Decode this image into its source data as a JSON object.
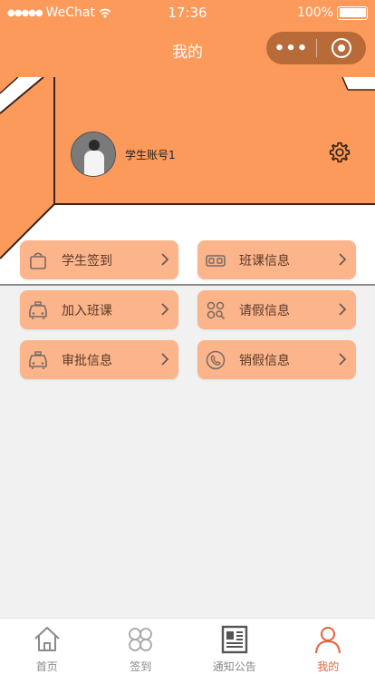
{
  "status_bar": {
    "carrier": "WeChat",
    "time": "17:36",
    "battery": "100%"
  },
  "nav": {
    "title": "我的"
  },
  "profile": {
    "username": "学生账号1"
  },
  "menu": [
    {
      "label": "学生签到",
      "icon": "bag-icon"
    },
    {
      "label": "班课信息",
      "icon": "vr-glasses-icon"
    },
    {
      "label": "加入班课",
      "icon": "taxi-icon"
    },
    {
      "label": "请假信息",
      "icon": "grid-search-icon"
    },
    {
      "label": "审批信息",
      "icon": "taxi-icon"
    },
    {
      "label": "销假信息",
      "icon": "phone-icon"
    }
  ],
  "tabbar": {
    "items": [
      {
        "label": "首页",
        "icon": "home-icon"
      },
      {
        "label": "签到",
        "icon": "clover-icon"
      },
      {
        "label": "通知公告",
        "icon": "newspaper-icon"
      },
      {
        "label": "我的",
        "icon": "user-icon"
      }
    ],
    "active_index": 3
  },
  "colors": {
    "primary": "#fb9a5a",
    "menu_bg": "#fcb48a",
    "active_tab": "#e8603c"
  }
}
